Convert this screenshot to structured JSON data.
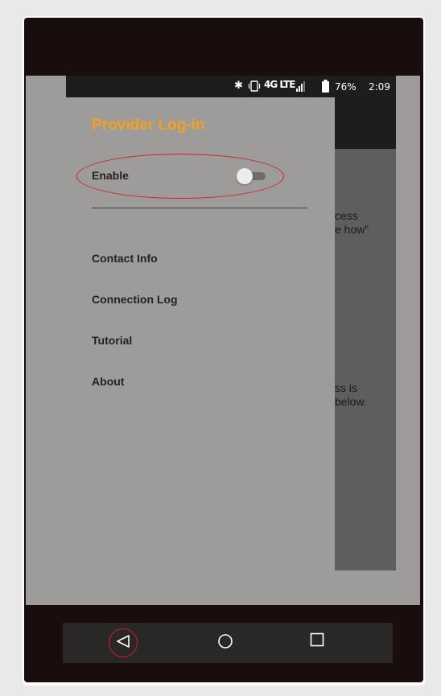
{
  "status_bar": {
    "bluetooth_icon": "bluetooth-icon",
    "vibrate_icon": "vibrate-icon",
    "network": "4G LTE",
    "battery_icon": "battery-icon",
    "battery": "76%",
    "time": "2:09"
  },
  "background": {
    "fragments": [
      "cess",
      "e how”",
      "ss is",
      "below."
    ]
  },
  "drawer": {
    "title": "Provider Log-in",
    "enable_label": "Enable",
    "enable_toggle": false,
    "menu_items": [
      "Contact Info",
      "Connection Log",
      "Tutorial",
      "About"
    ]
  },
  "nav_bar": {
    "back_icon": "back-triangle-icon",
    "home_icon": "home-circle-icon",
    "recents_icon": "recents-square-icon"
  },
  "colors": {
    "title_accent": "#f3a21e",
    "highlight": "#d0202a",
    "drawer_bg": "#9e9b9b"
  }
}
